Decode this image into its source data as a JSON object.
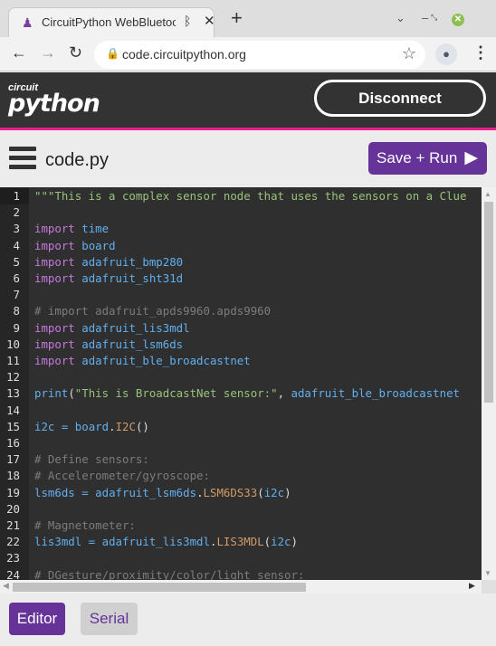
{
  "browser": {
    "tab_title": "CircuitPython WebBluetooth",
    "url": "code.circuitpython.org",
    "icons": [
      "python-favicon-icon",
      "bluetooth-icon",
      "close-icon",
      "plus-icon",
      "chevron-down-icon",
      "minimize-icon",
      "restore-icon",
      "close-window-icon",
      "back-icon",
      "forward-icon",
      "reload-icon",
      "lock-icon",
      "star-icon",
      "profile-icon",
      "kebab-menu-icon"
    ]
  },
  "header": {
    "logo_top": "circuit",
    "logo_bottom": "python",
    "disconnect_label": "Disconnect",
    "accent_color": "#e91e8c"
  },
  "toolbar": {
    "filename": "code.py",
    "save_run_label": "Save + Run",
    "button_color": "#663399"
  },
  "editor": {
    "lines": [
      [
        [
          "st",
          "\"\"\"This is a complex sensor node that uses the sensors on a Clue"
        ]
      ],
      [],
      [
        [
          "kw",
          "import"
        ],
        [
          "pn",
          " "
        ],
        [
          "nm",
          "time"
        ]
      ],
      [
        [
          "kw",
          "import"
        ],
        [
          "pn",
          " "
        ],
        [
          "nm",
          "board"
        ]
      ],
      [
        [
          "kw",
          "import"
        ],
        [
          "pn",
          " "
        ],
        [
          "nm",
          "adafruit_bmp280"
        ]
      ],
      [
        [
          "kw",
          "import"
        ],
        [
          "pn",
          " "
        ],
        [
          "nm",
          "adafruit_sht31d"
        ]
      ],
      [],
      [
        [
          "cm",
          "# import adafruit_apds9960.apds9960"
        ]
      ],
      [
        [
          "kw",
          "import"
        ],
        [
          "pn",
          " "
        ],
        [
          "nm",
          "adafruit_lis3mdl"
        ]
      ],
      [
        [
          "kw",
          "import"
        ],
        [
          "pn",
          " "
        ],
        [
          "nm",
          "adafruit_lsm6ds"
        ]
      ],
      [
        [
          "kw",
          "import"
        ],
        [
          "pn",
          " "
        ],
        [
          "nm",
          "adafruit_ble_broadcastnet"
        ]
      ],
      [],
      [
        [
          "nm",
          "print"
        ],
        [
          "pn",
          "("
        ],
        [
          "st",
          "\"This is BroadcastNet sensor:\""
        ],
        [
          "pn",
          ", "
        ],
        [
          "nm",
          "adafruit_ble_broadcastnet"
        ]
      ],
      [],
      [
        [
          "nm",
          "i2c"
        ],
        [
          "op",
          " = "
        ],
        [
          "nm",
          "board"
        ],
        [
          "pn",
          "."
        ],
        [
          "cl",
          "I2C"
        ],
        [
          "pn",
          "()"
        ]
      ],
      [],
      [
        [
          "cm",
          "# Define sensors:"
        ]
      ],
      [
        [
          "cm",
          "# Accelerometer/gyroscope:"
        ]
      ],
      [
        [
          "nm",
          "lsm6ds"
        ],
        [
          "op",
          " = "
        ],
        [
          "nm",
          "adafruit_lsm6ds"
        ],
        [
          "pn",
          "."
        ],
        [
          "cl",
          "LSM6DS33"
        ],
        [
          "pn",
          "("
        ],
        [
          "nm",
          "i2c"
        ],
        [
          "pn",
          ")"
        ]
      ],
      [],
      [
        [
          "cm",
          "# Magnetometer:"
        ]
      ],
      [
        [
          "nm",
          "lis3mdl"
        ],
        [
          "op",
          " = "
        ],
        [
          "nm",
          "adafruit_lis3mdl"
        ],
        [
          "pn",
          "."
        ],
        [
          "cl",
          "LIS3MDL"
        ],
        [
          "pn",
          "("
        ],
        [
          "nm",
          "i2c"
        ],
        [
          "pn",
          ")"
        ]
      ],
      [],
      [
        [
          "cm",
          "# DGesture/proximity/color/light sensor:"
        ]
      ]
    ]
  },
  "footer": {
    "editor_label": "Editor",
    "serial_label": "Serial"
  }
}
